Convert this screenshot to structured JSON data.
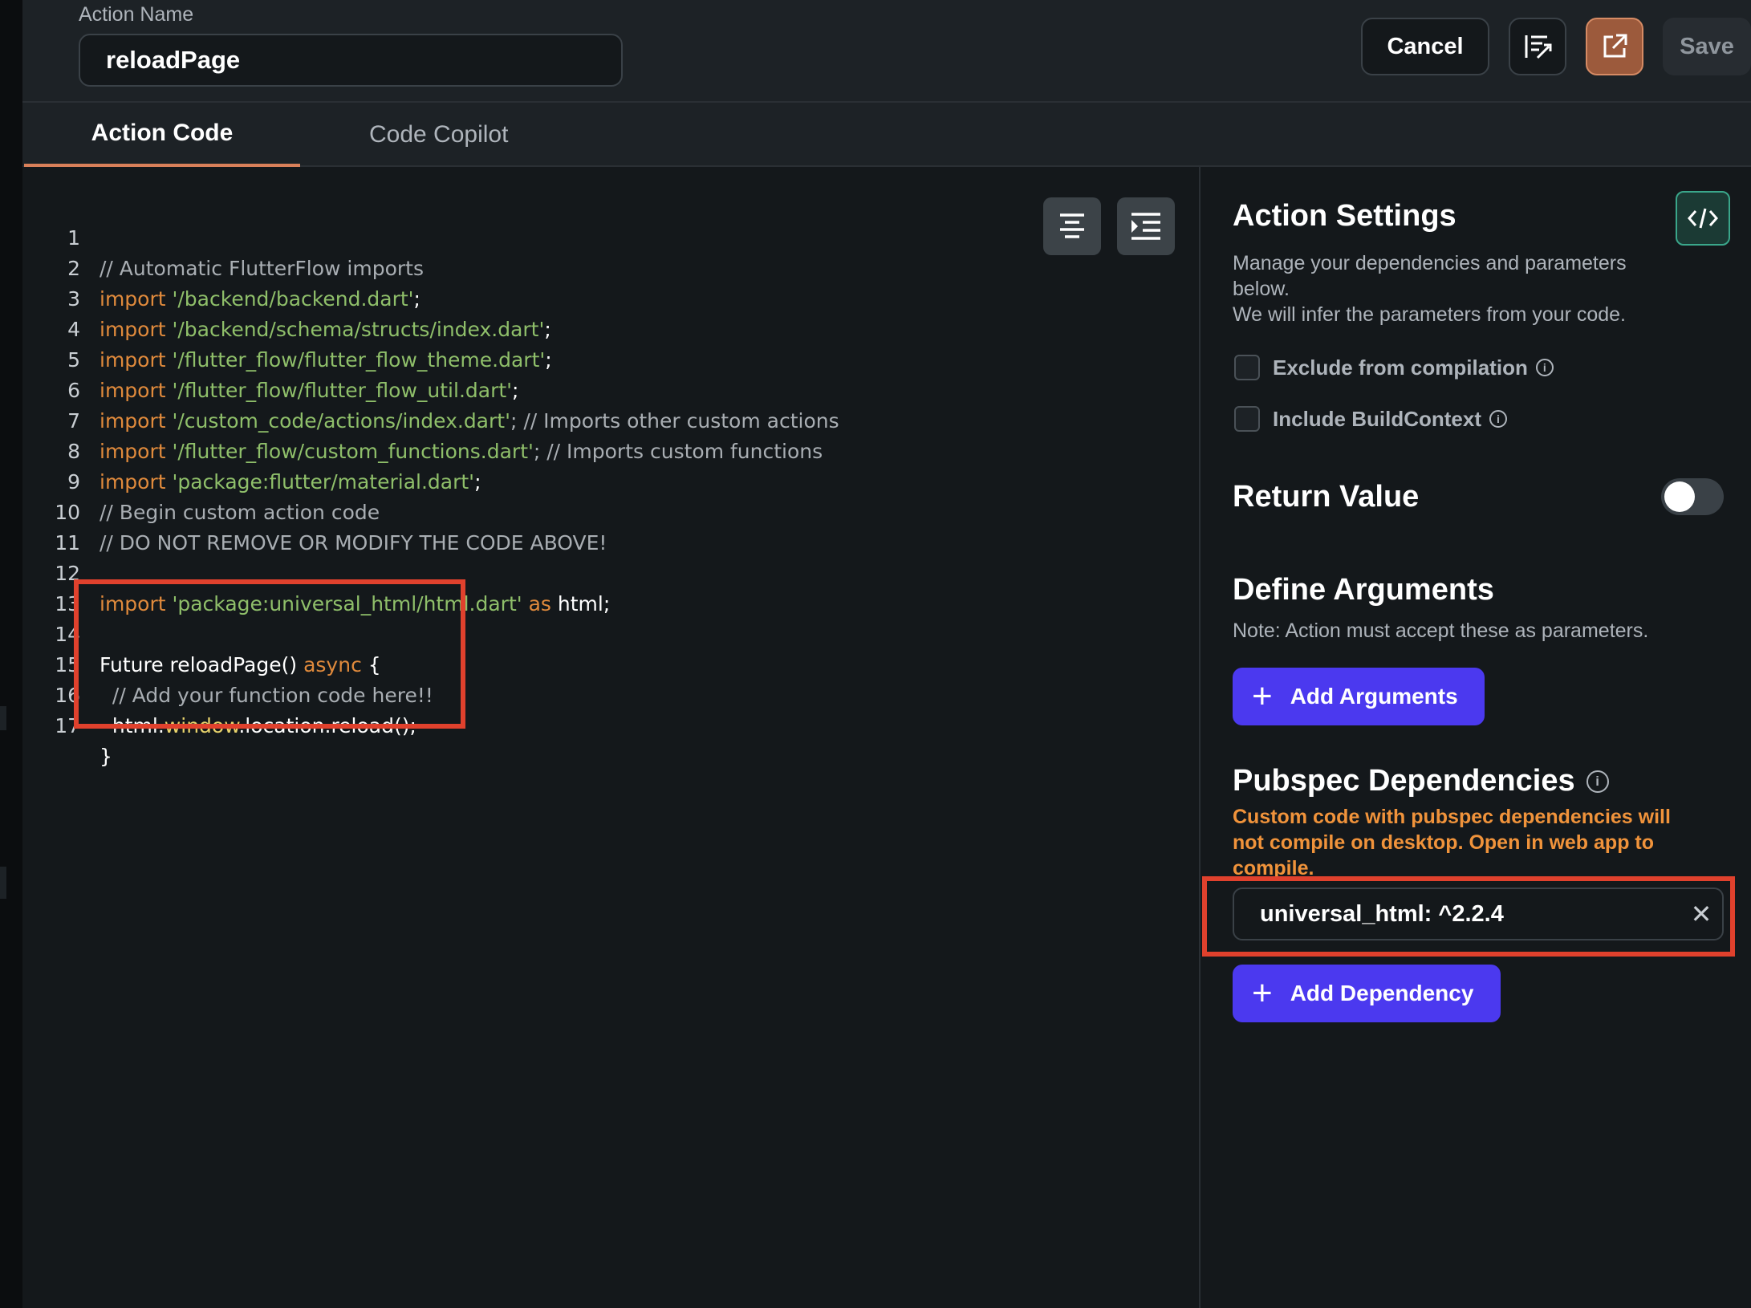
{
  "header": {
    "action_name_label": "Action Name",
    "action_name_value": "reloadPage",
    "cancel_label": "Cancel",
    "save_label": "Save"
  },
  "tabs": [
    {
      "label": "Action Code",
      "active": true
    },
    {
      "label": "Code Copilot",
      "active": false
    }
  ],
  "code": {
    "lines": [
      {
        "n": "1"
      },
      {
        "n": "2"
      },
      {
        "n": "3"
      },
      {
        "n": "4"
      },
      {
        "n": "5"
      },
      {
        "n": "6"
      },
      {
        "n": "7"
      },
      {
        "n": "8"
      },
      {
        "n": "9"
      },
      {
        "n": "10"
      },
      {
        "n": "11"
      },
      {
        "n": "12"
      },
      {
        "n": "13"
      },
      {
        "n": "14"
      },
      {
        "n": "15"
      },
      {
        "n": "16"
      },
      {
        "n": "17"
      }
    ],
    "t": {
      "l1": "// Automatic FlutterFlow imports",
      "import": "import",
      "semi": ";",
      "s2": "'/backend/backend.dart'",
      "s3": "'/backend/schema/structs/index.dart'",
      "s4": "'/flutter_flow/flutter_flow_theme.dart'",
      "s5": "'/flutter_flow/flutter_flow_util.dart'",
      "s6": "'/custom_code/actions/index.dart'",
      "c6": "; // Imports other custom actions",
      "s7": "'/flutter_flow/custom_functions.dart'",
      "c7": "; // Imports custom functions",
      "s8": "'package:flutter/material.dart'",
      "l9": "// Begin custom action code",
      "l10": "// DO NOT REMOVE OR MODIFY THE CODE ABOVE!",
      "s12": "'package:universal_html/html.dart'",
      "as": "as",
      "html12": "html;",
      "l14a": "Future reloadPage() ",
      "async": "async",
      "l14b": " {",
      "l15": "  // Add your function code here!!",
      "l16a": "  html.",
      "l16b": "window",
      "l16c": ".location.reload();",
      "l17": "}"
    }
  },
  "settings": {
    "title": "Action Settings",
    "description_1": "Manage your dependencies and parameters below.",
    "description_2": "We will infer the parameters from your code.",
    "exclude_label": "Exclude from compilation",
    "buildcontext_label": "Include BuildContext",
    "return_value_label": "Return Value",
    "return_value_on": false,
    "define_args_title": "Define Arguments",
    "define_args_note": "Note: Action must accept these as parameters.",
    "add_args_label": "Add Arguments",
    "pubspec_title": "Pubspec Dependencies",
    "pubspec_warning": "Custom code with pubspec dependencies will not compile on desktop. Open in web app to compile.",
    "dependency": "universal_html: ^2.2.4",
    "add_dependency_label": "Add Dependency"
  },
  "colors": {
    "accent_orange": "#d9805a",
    "primary_purple": "#4b39ef",
    "warning_orange": "#f0933b",
    "highlight_red": "#e0412d"
  },
  "icons": {
    "format": "format-code-icon",
    "open": "open-external-icon",
    "align": "align-center-icon",
    "indent": "indent-icon",
    "code_view": "code-brackets-icon",
    "info": "info-icon",
    "close": "close-icon",
    "plus": "plus-icon"
  }
}
